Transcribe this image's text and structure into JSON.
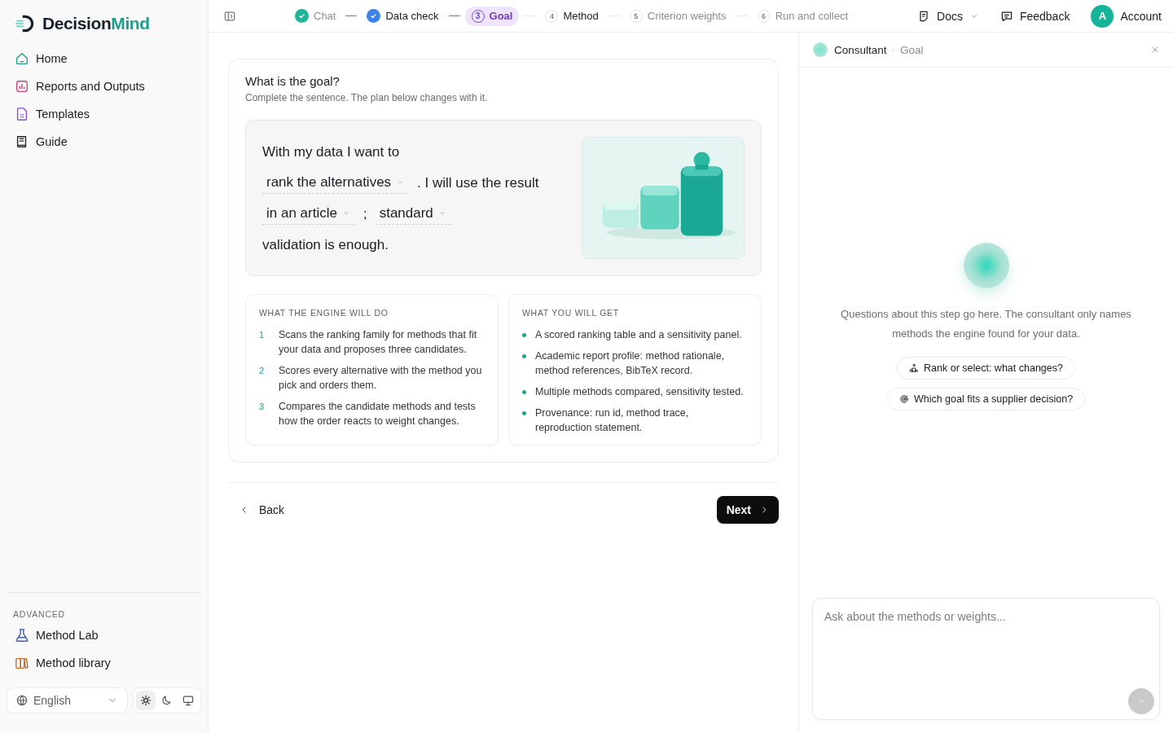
{
  "brand": {
    "name_part_1": "Decision",
    "name_part_2": "Mind"
  },
  "sidebar": {
    "items": [
      {
        "label": "Home",
        "color": "#1f9d8a"
      },
      {
        "label": "Reports and Outputs",
        "color": "#c0457a"
      },
      {
        "label": "Templates",
        "color": "#8a4fd1"
      },
      {
        "label": "Guide",
        "color": "#222222"
      }
    ],
    "advanced_heading": "ADVANCED",
    "advanced_items": [
      {
        "label": "Method Lab",
        "color": "#3b5ba8"
      },
      {
        "label": "Method library",
        "color": "#c56a22"
      }
    ],
    "language": "English",
    "theme_options": [
      {
        "selected": true
      },
      {
        "selected": false
      },
      {
        "selected": false
      }
    ]
  },
  "steps": [
    {
      "label": "Chat",
      "done": true,
      "selected": false,
      "color": "#1fb59b",
      "dim": true
    },
    {
      "label": "Data check",
      "done": true,
      "selected": false,
      "color": "#3b82e8",
      "dim": false
    },
    {
      "label": "Goal",
      "number": "3",
      "done": false,
      "selected": true,
      "dim": false
    },
    {
      "label": "Method",
      "number": "4",
      "done": false,
      "selected": false,
      "dim": false
    },
    {
      "label": "Criterion weights",
      "number": "5",
      "done": false,
      "selected": false,
      "dim": true
    },
    {
      "label": "Run and collect",
      "number": "6",
      "done": false,
      "selected": false,
      "dim": true
    }
  ],
  "header_actions": {
    "docs": "Docs",
    "feedback": "Feedback",
    "avatar": "A",
    "account": "Account"
  },
  "goal": {
    "title": "What is the goal?",
    "subtitle": "Complete the sentence. The plan below changes with it.",
    "sentence_lines": [
      [
        {
          "kind": "text",
          "text": "With my data I want to"
        }
      ],
      [
        {
          "kind": "select",
          "text": "rank the alternatives"
        },
        {
          "kind": "text",
          "text": ". I will use the result"
        }
      ],
      [
        {
          "kind": "select",
          "text": "in an article"
        },
        {
          "kind": "text",
          "text": ";"
        },
        {
          "kind": "select",
          "text": "standard"
        }
      ],
      [
        {
          "kind": "text",
          "text": "validation is enough."
        }
      ]
    ],
    "engine": {
      "heading": "WHAT THE ENGINE WILL DO",
      "items": [
        {
          "number": "1",
          "text": "Scans the ranking family for methods that fit your data and proposes three candidates."
        },
        {
          "number": "2",
          "text": "Scores every alternative with the method you pick and orders them."
        },
        {
          "number": "3",
          "text": "Compares the candidate methods and tests how the order reacts to weight changes."
        }
      ]
    },
    "outputs": {
      "heading": "WHAT YOU WILL GET",
      "items": [
        "A scored ranking table and a sensitivity panel.",
        "Academic report profile: method rationale, method references, BibTeX record.",
        "Multiple methods compared, sensitivity tested.",
        "Provenance: run id, method trace, reproduction statement."
      ]
    }
  },
  "nav": {
    "back": "Back",
    "next": "Next"
  },
  "consultant": {
    "title": "Consultant",
    "separator": "·",
    "step": "Goal",
    "intro": "Questions about this step go here. The consultant only names methods the engine found for your data.",
    "suggestions": [
      {
        "text": "Rank or select: what changes?"
      },
      {
        "text": "Which goal fits a supplier decision?"
      }
    ],
    "placeholder": "Ask about the methods or weights..."
  }
}
